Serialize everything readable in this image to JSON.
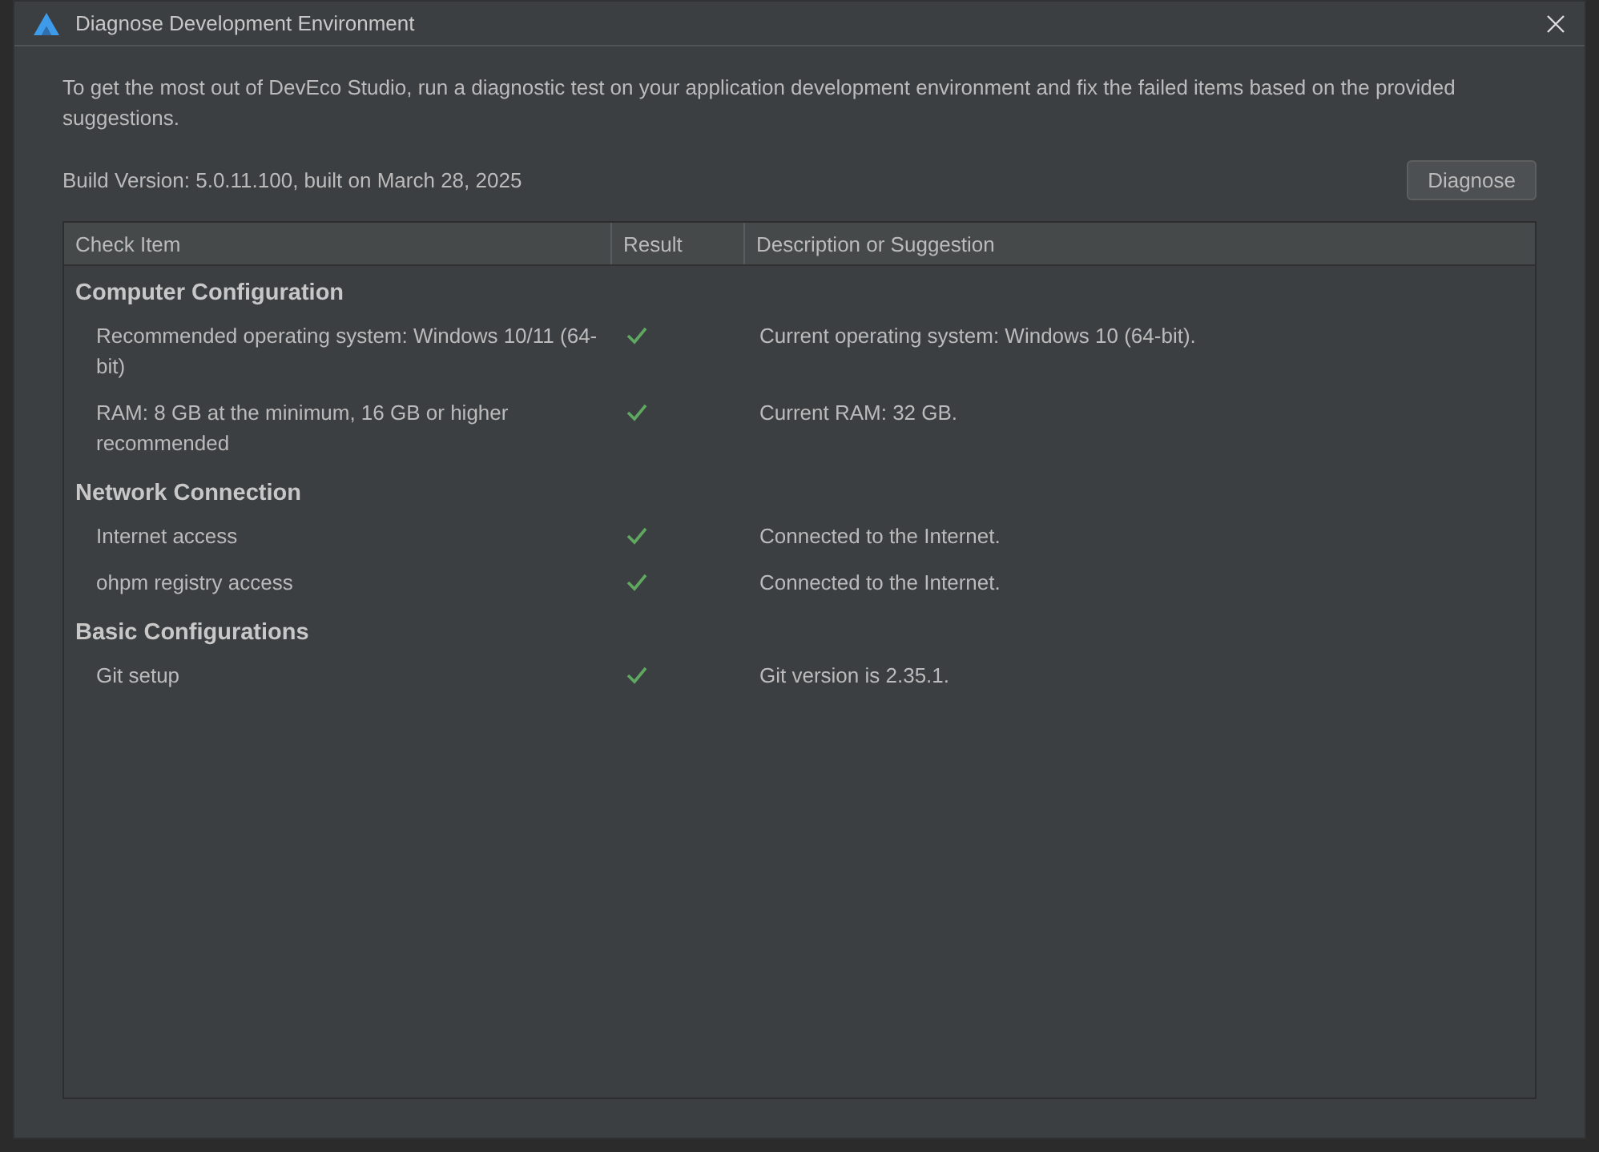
{
  "window": {
    "title": "Diagnose Development Environment"
  },
  "intro": "To get the most out of DevEco Studio, run a diagnostic test on your application development environment and fix the failed items based on the provided suggestions.",
  "build_version": "Build Version: 5.0.11.100, built on March 28, 2025",
  "diagnose_button": "Diagnose",
  "table": {
    "columns": [
      "Check Item",
      "Result",
      "Description or Suggestion"
    ],
    "groups": [
      {
        "title": "Computer Configuration",
        "rows": [
          {
            "item": "Recommended operating system: Windows 10/11 (64-bit)",
            "passed": true,
            "description": "Current operating system: Windows 10 (64-bit)."
          },
          {
            "item": "RAM: 8 GB at the minimum, 16 GB or higher recommended",
            "passed": true,
            "description": "Current RAM: 32 GB."
          }
        ]
      },
      {
        "title": "Network Connection",
        "rows": [
          {
            "item": "Internet access",
            "passed": true,
            "description": "Connected to the Internet."
          },
          {
            "item": "ohpm registry access",
            "passed": true,
            "description": "Connected to the Internet."
          }
        ]
      },
      {
        "title": "Basic Configurations",
        "rows": [
          {
            "item": "Git setup",
            "passed": true,
            "description": "Git version is 2.35.1."
          }
        ]
      }
    ]
  }
}
